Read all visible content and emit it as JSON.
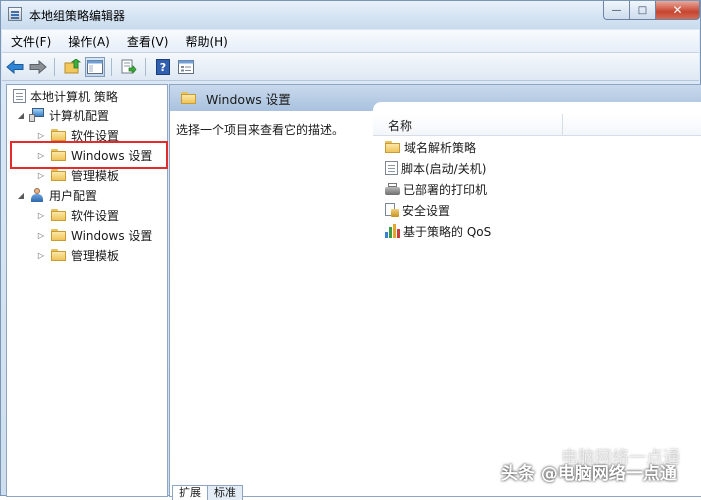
{
  "window": {
    "title": "本地组策略编辑器",
    "controls": {
      "minimize": "—",
      "maximize": "□",
      "close": "✕"
    }
  },
  "menu": [
    {
      "label": "文件(F)"
    },
    {
      "label": "操作(A)"
    },
    {
      "label": "查看(V)"
    },
    {
      "label": "帮助(H)"
    }
  ],
  "toolbar": {
    "back_icon": "back-arrow-icon",
    "forward_icon": "forward-arrow-icon",
    "up_icon": "up-folder-icon",
    "show_hide_tree_icon": "console-tree-icon",
    "export_icon": "export-list-icon",
    "help_icon": "help-icon",
    "properties_icon": "properties-icon"
  },
  "tree": {
    "root": "本地计算机 策略",
    "computer_config": "计算机配置",
    "computer_children": [
      {
        "label": "软件设置"
      },
      {
        "label": "Windows 设置"
      },
      {
        "label": "管理模板"
      }
    ],
    "user_config": "用户配置",
    "user_children": [
      {
        "label": "软件设置"
      },
      {
        "label": "Windows 设置"
      },
      {
        "label": "管理模板"
      }
    ],
    "highlight_color": "#e32b2b"
  },
  "detail": {
    "header": "Windows 设置",
    "description": "选择一个项目来查看它的描述。",
    "column_name": "名称",
    "items": [
      {
        "label": "域名解析策略",
        "icon": "folder-icon"
      },
      {
        "label": "脚本(启动/关机)",
        "icon": "script-icon"
      },
      {
        "label": "已部署的打印机",
        "icon": "printer-icon"
      },
      {
        "label": "安全设置",
        "icon": "security-icon"
      },
      {
        "label": "基于策略的 QoS",
        "icon": "qos-chart-icon"
      }
    ]
  },
  "tabs": [
    {
      "label": "扩展"
    },
    {
      "label": "标准"
    }
  ],
  "watermark": {
    "text": "头条 @电脑网络一点通",
    "ghost": "电脑网络一点通"
  }
}
